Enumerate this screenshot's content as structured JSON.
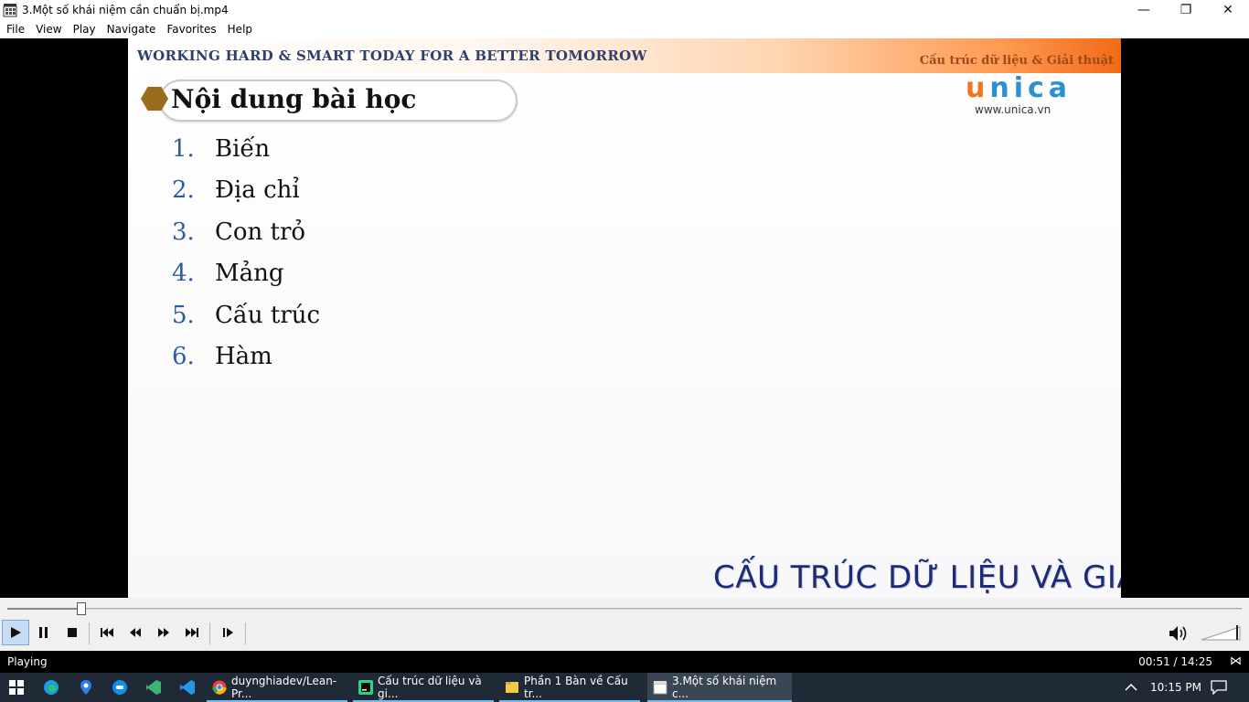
{
  "window": {
    "title": "3.Một số khái niệm cần chuẩn bị.mp4",
    "minimize_glyph": "—",
    "restore_glyph": "❐",
    "close_glyph": "✕"
  },
  "menu": [
    "File",
    "View",
    "Play",
    "Navigate",
    "Favorites",
    "Help"
  ],
  "slide": {
    "tagline": "WORKING HARD & SMART TODAY FOR A BETTER TOMORROW",
    "course_title": "Cấu trúc dữ liệu & Giải thuật",
    "logo_first": "u",
    "logo_rest": "nica",
    "logo_url": "www.unica.vn",
    "section_title": "Nội dung bài học",
    "topics": [
      {
        "num": "1.",
        "label": "Biến"
      },
      {
        "num": "2.",
        "label": "Địa chỉ"
      },
      {
        "num": "3.",
        "label": "Con trỏ"
      },
      {
        "num": "4.",
        "label": "Mảng"
      },
      {
        "num": "5.",
        "label": "Cấu trúc"
      },
      {
        "num": "6.",
        "label": "Hàm"
      }
    ],
    "big_title": "CẤU TRÚC DỮ LIỆU VÀ GIẢI"
  },
  "playback": {
    "progress_fraction": 0.0595,
    "status": "Playing",
    "time": "00:51 / 14:25"
  },
  "taskbar": {
    "tasks": [
      {
        "label": "duynghiadev/Lean-Pr...",
        "color": "#e8453c"
      },
      {
        "label": "Cấu trúc dữ liệu và gi...",
        "color": "#21d789"
      },
      {
        "label": "Phần 1 Bàn về Cấu tr...",
        "color": "#f2c94c"
      },
      {
        "label": "3.Một số khái niệm c...",
        "color": "#cccccc"
      }
    ],
    "clock": "10:15 PM"
  },
  "colors": {
    "accent": "#2b8fd0",
    "logo_orange": "#f0761e",
    "header_orange": "#f26a16",
    "taskbar_bg": "#1f2a36"
  }
}
